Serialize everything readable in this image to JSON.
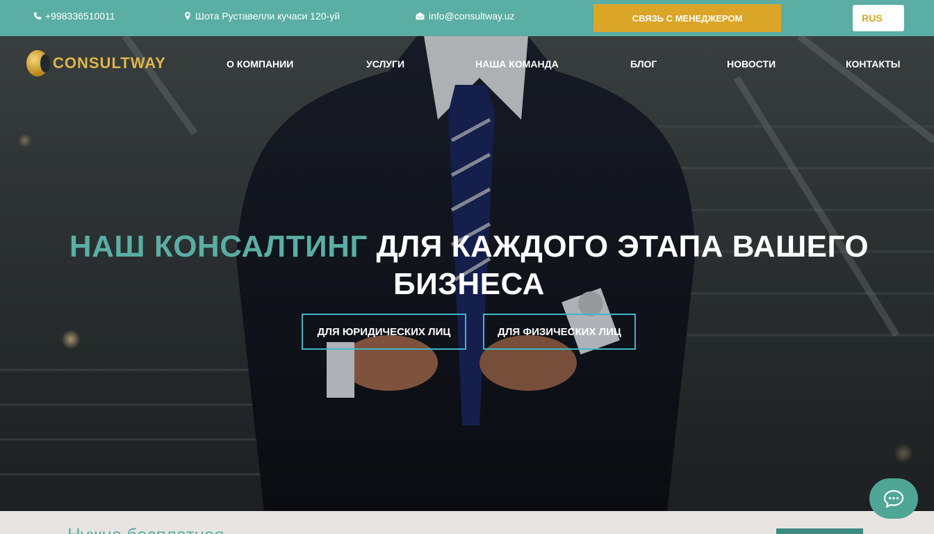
{
  "topbar": {
    "phone": "+998336510011",
    "address": "Шота Руставелли кучаси 120-уй",
    "email": "info@consultway.uz",
    "manager_button": "СВЯЗЬ С МЕНЕДЖЕРОМ",
    "language": "RUS"
  },
  "nav": {
    "logo": "CONSULTWAY",
    "items": [
      "О КОМПАНИИ",
      "УСЛУГИ",
      "НАША КОМАНДА",
      "БЛОГ",
      "НОВОСТИ",
      "КОНТАКТЫ"
    ]
  },
  "hero": {
    "headline_accent": "НАШ КОНСАЛТИНГ",
    "headline_rest": "ДЛЯ КАЖДОГО ЭТАПА ВАШЕГО БИЗНЕСА",
    "cta_legal": "ДЛЯ ЮРИДИЧЕСКИХ ЛИЦ",
    "cta_personal": "ДЛЯ ФИЗИЧЕСКИХ ЛИЦ"
  },
  "bottom": {
    "title": "Нужна бесплатная"
  },
  "colors": {
    "topbar": "#5aaea3",
    "accent_gold": "#dba527",
    "cta_border": "#3fb7c9"
  }
}
